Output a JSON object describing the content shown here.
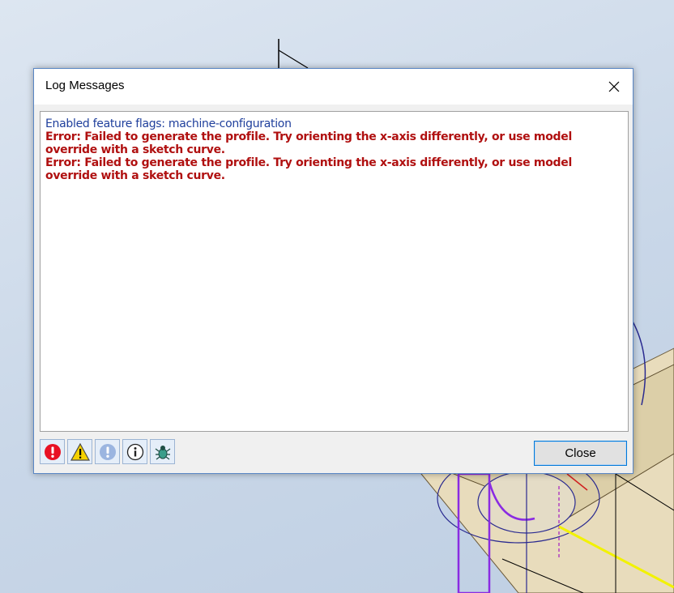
{
  "dialog": {
    "title": "Log Messages",
    "close_icon": "close-icon",
    "close_button_label": "Close"
  },
  "log": {
    "messages": [
      {
        "type": "info",
        "text": "Enabled feature flags: machine-configuration"
      },
      {
        "type": "error",
        "text": "Error: Failed to generate the profile. Try orienting the x-axis differently, or use model override with a sketch curve."
      },
      {
        "type": "error",
        "text": "Error: Failed to generate the profile. Try orienting the x-axis differently, or use model override with a sketch curve."
      }
    ]
  },
  "toolbar": {
    "filters": [
      {
        "name": "filter-errors-button",
        "icon": "error-icon"
      },
      {
        "name": "filter-warnings-button",
        "icon": "warning-icon"
      },
      {
        "name": "filter-notices-button",
        "icon": "notice-icon"
      },
      {
        "name": "filter-info-button",
        "icon": "info-icon"
      },
      {
        "name": "filter-debug-button",
        "icon": "bug-icon"
      }
    ]
  },
  "colors": {
    "info_text": "#1f3f9c",
    "error_text": "#b01010",
    "accent": "#0078d7",
    "error_icon": "#e81123",
    "warning_icon": "#f5d100"
  }
}
